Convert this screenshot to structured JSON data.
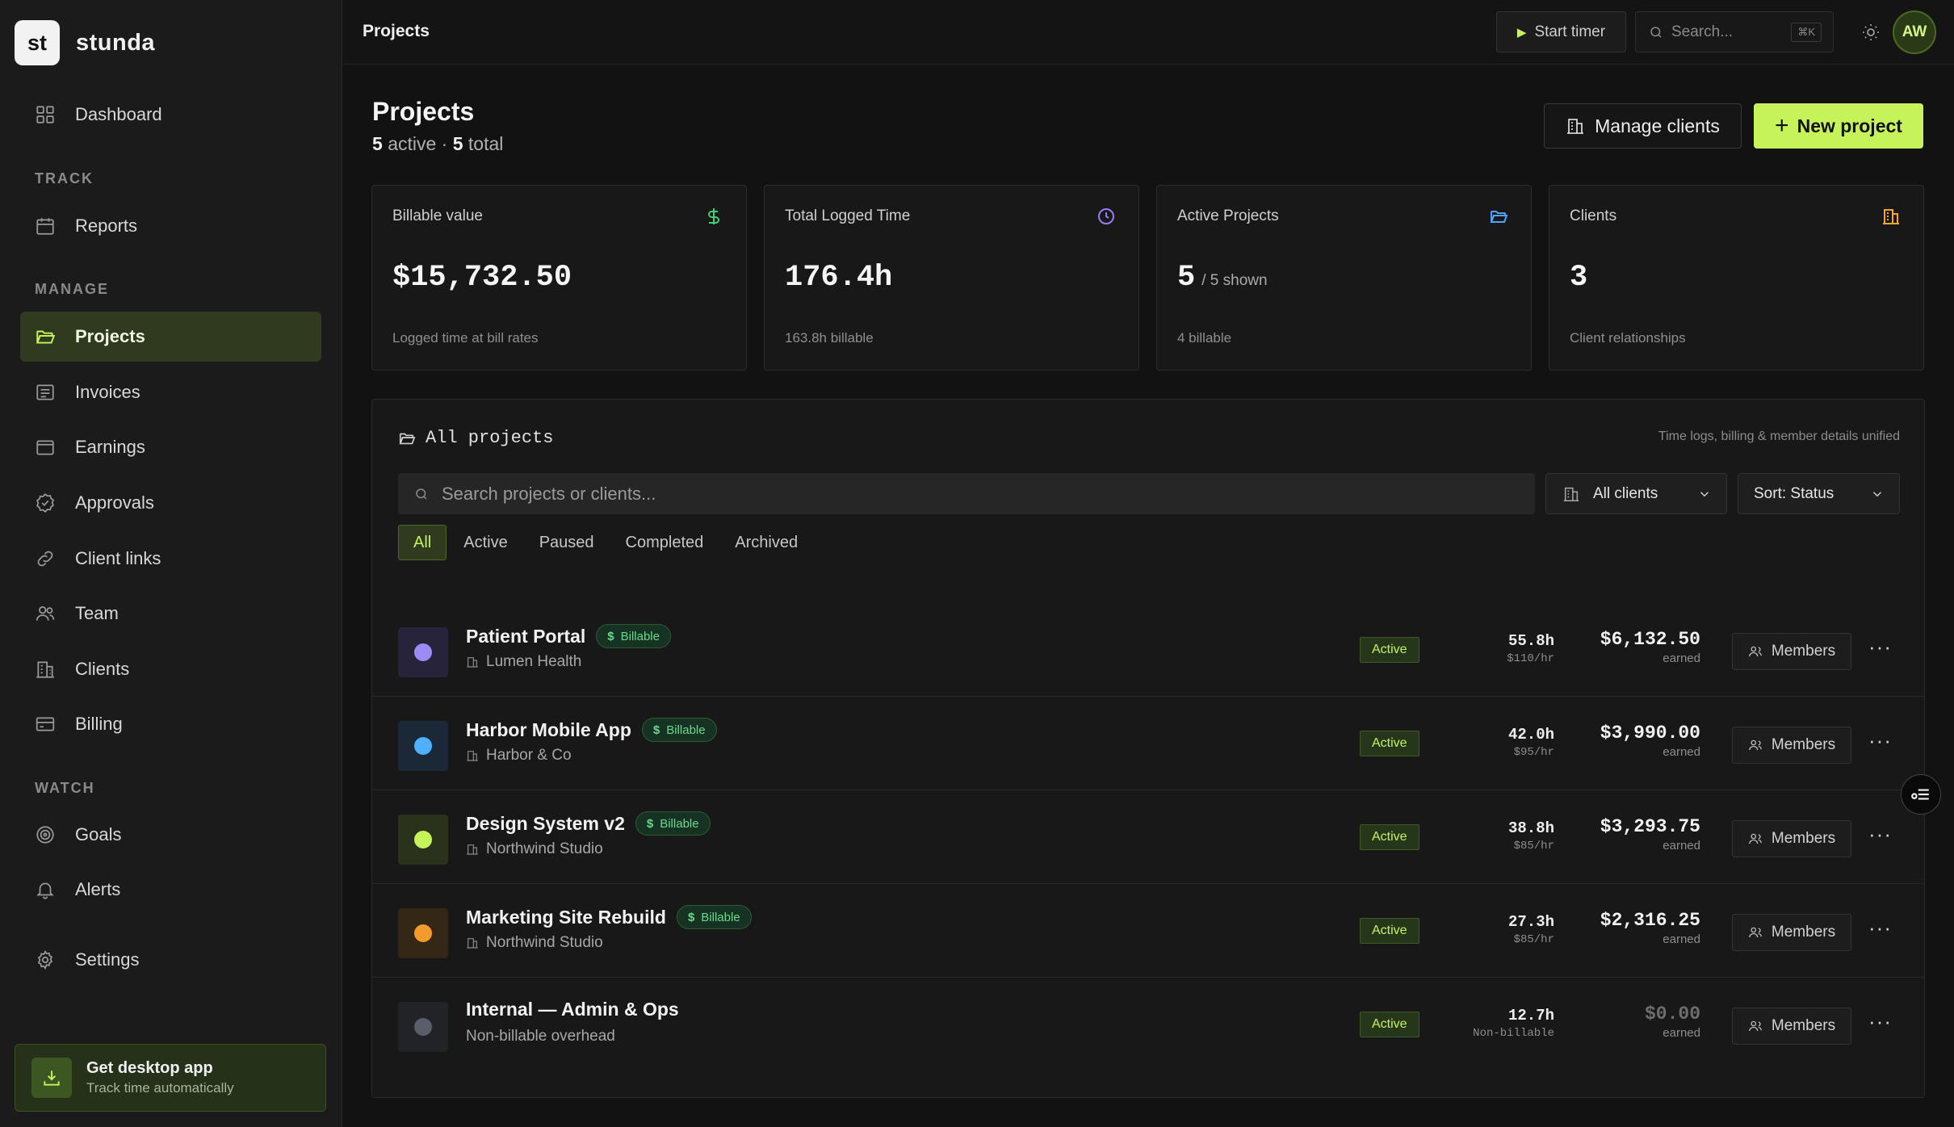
{
  "brand": {
    "mark": "st",
    "name": "stunda"
  },
  "sidebar": {
    "dashboard": "Dashboard",
    "sections": {
      "track": "TRACK",
      "manage": "MANAGE",
      "watch": "WATCH"
    },
    "items": {
      "reports": "Reports",
      "projects": "Projects",
      "invoices": "Invoices",
      "earnings": "Earnings",
      "approvals": "Approvals",
      "client_links": "Client links",
      "team": "Team",
      "clients": "Clients",
      "billing": "Billing",
      "goals": "Goals",
      "alerts": "Alerts",
      "settings": "Settings"
    },
    "desktop_card": {
      "title": "Get desktop app",
      "subtitle": "Track time automatically"
    }
  },
  "topbar": {
    "breadcrumb": "Projects",
    "start_timer": "Start timer",
    "search_placeholder": "Search...",
    "search_shortcut": "⌘K",
    "avatar_initials": "AW"
  },
  "header": {
    "title": "Projects",
    "active_count": "5",
    "active_label": "active",
    "separator": "·",
    "total_count": "5",
    "total_label": "total",
    "manage_clients": "Manage clients",
    "new_project": "New project"
  },
  "stats": [
    {
      "label": "Billable value",
      "value": "$15,732.50",
      "suffix": "",
      "note": "Logged time at bill rates",
      "icon": "dollar-icon",
      "color": "#3fcf7a"
    },
    {
      "label": "Total Logged Time",
      "value": "176.4h",
      "suffix": "",
      "note": "163.8h billable",
      "icon": "clock-icon",
      "color": "#9b7cf5"
    },
    {
      "label": "Active Projects",
      "value": "5",
      "suffix": "/ 5 shown",
      "note": "4 billable",
      "icon": "folder-icon",
      "color": "#4da3ff"
    },
    {
      "label": "Clients",
      "value": "3",
      "suffix": "",
      "note": "Client relationships",
      "icon": "building-icon",
      "color": "#f5a623"
    }
  ],
  "panel": {
    "title": "All projects",
    "note": "Time logs, billing & member details unified",
    "search_placeholder": "Search projects or clients...",
    "client_filter": "All clients",
    "sort": "Sort: Status",
    "tabs": [
      "All",
      "Active",
      "Paused",
      "Completed",
      "Archived"
    ],
    "active_tab": "All"
  },
  "projects": [
    {
      "name": "Patient Portal",
      "billable_badge": "Billable",
      "client": "Lumen Health",
      "status": "Active",
      "hours": "55.8h",
      "rate": "$110/hr",
      "earned": "$6,132.50",
      "earned_label": "earned",
      "members": "Members",
      "dot": "#9b8cf5",
      "swatch": "#26233a"
    },
    {
      "name": "Harbor Mobile App",
      "billable_badge": "Billable",
      "client": "Harbor & Co",
      "status": "Active",
      "hours": "42.0h",
      "rate": "$95/hr",
      "earned": "$3,990.00",
      "earned_label": "earned",
      "members": "Members",
      "dot": "#4fb0ff",
      "swatch": "#1a2838"
    },
    {
      "name": "Design System v2",
      "billable_badge": "Billable",
      "client": "Northwind Studio",
      "status": "Active",
      "hours": "38.8h",
      "rate": "$85/hr",
      "earned": "$3,293.75",
      "earned_label": "earned",
      "members": "Members",
      "dot": "#c6f35a",
      "swatch": "#2a321b"
    },
    {
      "name": "Marketing Site Rebuild",
      "billable_badge": "Billable",
      "client": "Northwind Studio",
      "status": "Active",
      "hours": "27.3h",
      "rate": "$85/hr",
      "earned": "$2,316.25",
      "earned_label": "earned",
      "members": "Members",
      "dot": "#f39a2c",
      "swatch": "#352716"
    },
    {
      "name": "Internal — Admin & Ops",
      "billable_badge": "",
      "client": "Non-billable overhead",
      "status": "Active",
      "hours": "12.7h",
      "rate": "Non-billable",
      "earned": "$0.00",
      "earned_label": "earned",
      "members": "Members",
      "dot": "#5a5e6a",
      "swatch": "#222326"
    }
  ]
}
